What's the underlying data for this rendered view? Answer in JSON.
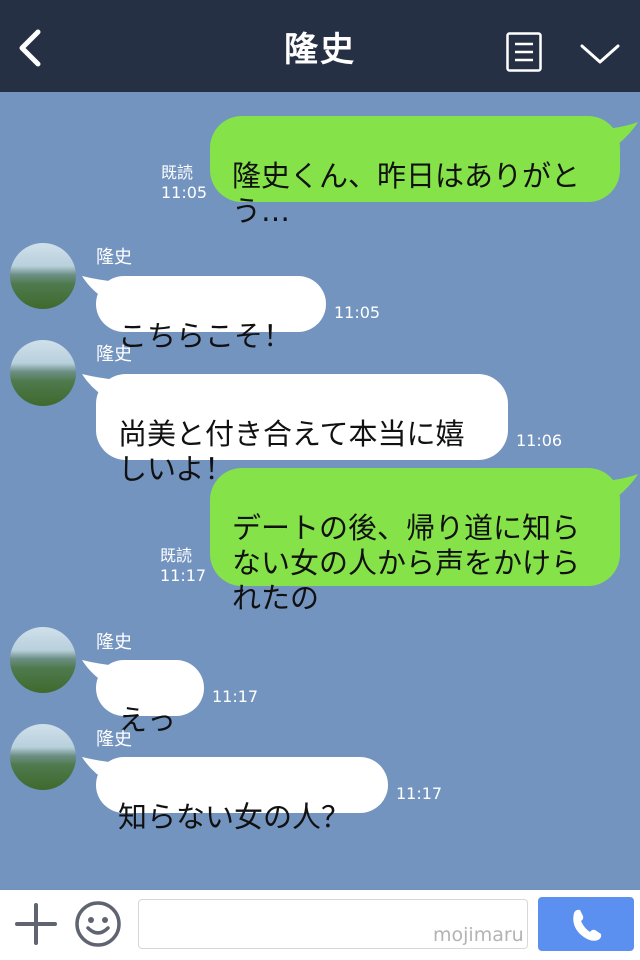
{
  "header": {
    "title": "隆史",
    "back_icon": "chevron-left-icon",
    "menu_icon": "list-icon",
    "collapse_icon": "chevron-down-icon"
  },
  "colors": {
    "header_bg": "#263044",
    "chat_bg": "#7494c0",
    "my_bubble": "#85e249",
    "their_bubble": "#ffffff",
    "call_button": "#5b8ff0"
  },
  "messages": [
    {
      "from": "me",
      "text": "隆史くん、昨日はありがと\nう…",
      "read": "既読",
      "time": "11:05"
    },
    {
      "from": "them",
      "sender": "隆史",
      "text": "こちらこそ！",
      "time": "11:05"
    },
    {
      "from": "them",
      "sender": "隆史",
      "text": "尚美と付き合えて本当に嬉\nしいよ！",
      "time": "11:06"
    },
    {
      "from": "me",
      "text": "デートの後、帰り道に知ら\nない女の人から声をかけら\nれたの",
      "read": "既読",
      "time": "11:17"
    },
    {
      "from": "them",
      "sender": "隆史",
      "text": "えっ",
      "time": "11:17"
    },
    {
      "from": "them",
      "sender": "隆史",
      "text": "知らない女の人？",
      "time": "11:17"
    }
  ],
  "footer": {
    "plus_icon": "plus-icon",
    "emoji_icon": "emoji-icon",
    "input_value": "",
    "watermark": "mojimaru",
    "call_icon": "phone-icon"
  }
}
